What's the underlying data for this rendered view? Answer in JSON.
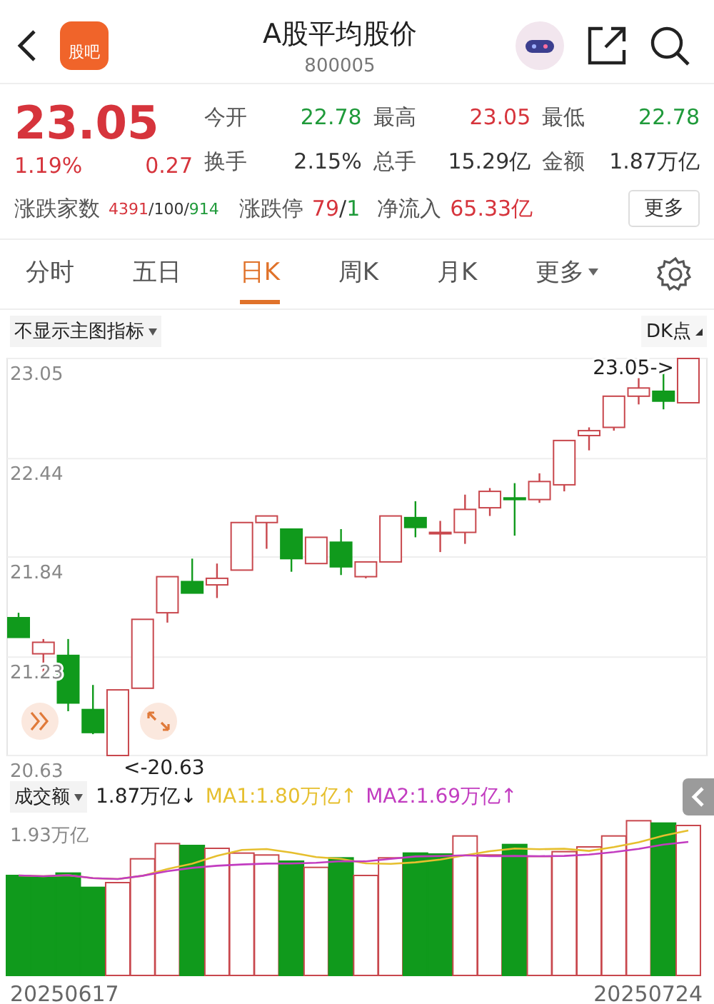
{
  "header": {
    "logo_text": "股吧",
    "title": "A股平均股价",
    "code": "800005"
  },
  "quote": {
    "price": "23.05",
    "change_pct": "1.19%",
    "change": "0.27",
    "color": "#d6343c",
    "stats": [
      {
        "label": "今开",
        "value": "22.78",
        "color": "#1f9a3a"
      },
      {
        "label": "最高",
        "value": "23.05",
        "color": "#d6343c"
      },
      {
        "label": "最低",
        "value": "22.78",
        "color": "#1f9a3a"
      },
      {
        "label": "换手",
        "value": "2.15%",
        "color": "#333333"
      },
      {
        "label": "总手",
        "value": "15.29亿",
        "color": "#333333"
      },
      {
        "label": "金额",
        "value": "1.87万亿",
        "color": "#333333"
      }
    ],
    "breadth": {
      "label": "涨跌家数",
      "parts": [
        {
          "text": "4391",
          "color": "#d6343c"
        },
        {
          "text": "/100/",
          "color": "#333333"
        },
        {
          "text": "914",
          "color": "#1f9a3a"
        }
      ]
    },
    "limits": {
      "label": "涨跌停",
      "parts": [
        {
          "text": "79",
          "color": "#d6343c"
        },
        {
          "text": "/",
          "color": "#333333"
        },
        {
          "text": "1",
          "color": "#1f9a3a"
        }
      ]
    },
    "inflow": {
      "label": "净流入",
      "value": "65.33亿",
      "color": "#d6343c"
    },
    "more_button": "更多"
  },
  "tabs": [
    {
      "label": "分时",
      "selected": false,
      "dropdown": false
    },
    {
      "label": "五日",
      "selected": false,
      "dropdown": false
    },
    {
      "label": "日K",
      "selected": true,
      "dropdown": false
    },
    {
      "label": "周K",
      "selected": false,
      "dropdown": false
    },
    {
      "label": "月K",
      "selected": false,
      "dropdown": false
    },
    {
      "label": "更多",
      "selected": false,
      "dropdown": true
    }
  ],
  "indicator": {
    "label": "不显示主图指标",
    "dk_label": "DK点"
  },
  "price_chart": {
    "max_label": "23.05->",
    "min_label": "<-20.63",
    "chart_data": {
      "type": "candlestick",
      "ylim": [
        20.63,
        23.05
      ],
      "yticks": [
        23.05,
        22.44,
        21.84,
        21.23,
        20.63
      ],
      "grid": true,
      "ohlc": [
        [
          21.47,
          21.5,
          21.35,
          21.35
        ],
        [
          21.25,
          21.34,
          21.14,
          21.32
        ],
        [
          21.24,
          21.34,
          20.9,
          20.95
        ],
        [
          20.91,
          21.06,
          20.76,
          20.77
        ],
        [
          20.63,
          21.03,
          20.63,
          21.03
        ],
        [
          21.04,
          21.46,
          21.04,
          21.46
        ],
        [
          21.5,
          21.72,
          21.44,
          21.72
        ],
        [
          21.69,
          21.83,
          21.62,
          21.62
        ],
        [
          21.67,
          21.8,
          21.59,
          21.71
        ],
        [
          21.76,
          22.05,
          21.76,
          22.05
        ],
        [
          22.05,
          22.09,
          21.89,
          22.09
        ],
        [
          22.01,
          22.01,
          21.75,
          21.83
        ],
        [
          21.8,
          21.96,
          21.8,
          21.96
        ],
        [
          21.93,
          22.01,
          21.73,
          21.78
        ],
        [
          21.72,
          21.81,
          21.71,
          21.81
        ],
        [
          21.81,
          22.09,
          21.81,
          22.09
        ],
        [
          22.08,
          22.18,
          21.96,
          22.02
        ],
        [
          21.99,
          22.06,
          21.87,
          21.99
        ],
        [
          21.99,
          22.22,
          21.92,
          22.13
        ],
        [
          22.14,
          22.26,
          22.09,
          22.24
        ],
        [
          22.2,
          22.29,
          21.97,
          22.19
        ],
        [
          22.19,
          22.35,
          22.17,
          22.3
        ],
        [
          22.28,
          22.55,
          22.24,
          22.55
        ],
        [
          22.58,
          22.63,
          22.49,
          22.61
        ],
        [
          22.63,
          22.82,
          22.61,
          22.82
        ],
        [
          22.82,
          22.93,
          22.77,
          22.87
        ],
        [
          22.85,
          22.96,
          22.74,
          22.79
        ],
        [
          22.78,
          23.05,
          22.78,
          23.05
        ]
      ]
    }
  },
  "volume": {
    "selector": "成交额",
    "value": "1.87万亿↓",
    "ma": [
      {
        "label": "MA1:1.80万亿↑",
        "color": "#e6bf2e"
      },
      {
        "label": "MA2:1.69万亿↑",
        "color": "#c23cc0"
      }
    ],
    "max_label": "1.93万亿",
    "start_date": "20250617",
    "end_date": "20250724"
  }
}
